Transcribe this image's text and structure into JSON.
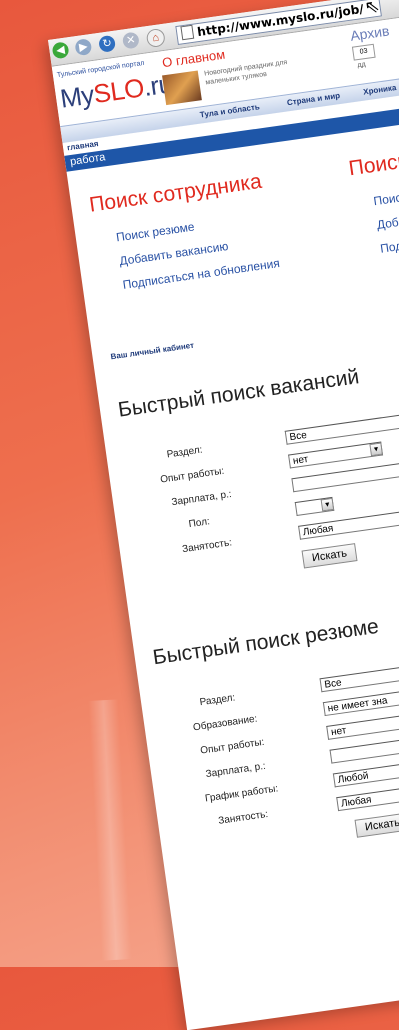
{
  "browser": {
    "url": "http://www.myslo.ru/job/",
    "back_icon": "back-arrow-icon",
    "forward_icon": "forward-arrow-icon",
    "refresh_icon": "refresh-icon",
    "stop_icon": "stop-icon",
    "home_icon": "home-icon"
  },
  "header": {
    "portal_text": "Тульский городской портал",
    "logo_prefix": "My",
    "logo_brand": "SLO",
    "logo_suffix": ".ru",
    "about_link": "О главном",
    "holiday_text": "Новогодний праздник для маленьких туляков",
    "archive": "Архив",
    "date_box": "03",
    "date_label": "дд"
  },
  "nav": {
    "items": [
      "Тула и область",
      "Страна и мир",
      "Хроника"
    ],
    "home": "главная",
    "section": "работа"
  },
  "employer": {
    "title": "Поиск сотрудника",
    "links": [
      "Поиск резюме",
      "Добавить вакансию",
      "Подписаться на обновления"
    ]
  },
  "seeker_cut": {
    "title": "Поиск",
    "links": [
      "Поиск",
      "Добав",
      "Подпи"
    ]
  },
  "cabinet_link": "Ваш личный кабинет",
  "vacancy_search": {
    "title": "Быстрый поиск вакансий",
    "labels": [
      "Раздел:",
      "Опыт работы:",
      "Зарплата, р.:",
      "Пол:",
      "Занятость:"
    ],
    "values": [
      "Все",
      "нет",
      "",
      "",
      "Любая"
    ],
    "button": "Искать"
  },
  "resume_search": {
    "title": "Быстрый поиск резюме",
    "labels": [
      "Раздел:",
      "Образование:",
      "Опыт работы:",
      "Зарплата, р.:",
      "График работы:",
      "Занятость:"
    ],
    "values": [
      "Все",
      "не имеет зна",
      "нет",
      "",
      "Любой",
      "Любая"
    ],
    "button": "Искать"
  }
}
